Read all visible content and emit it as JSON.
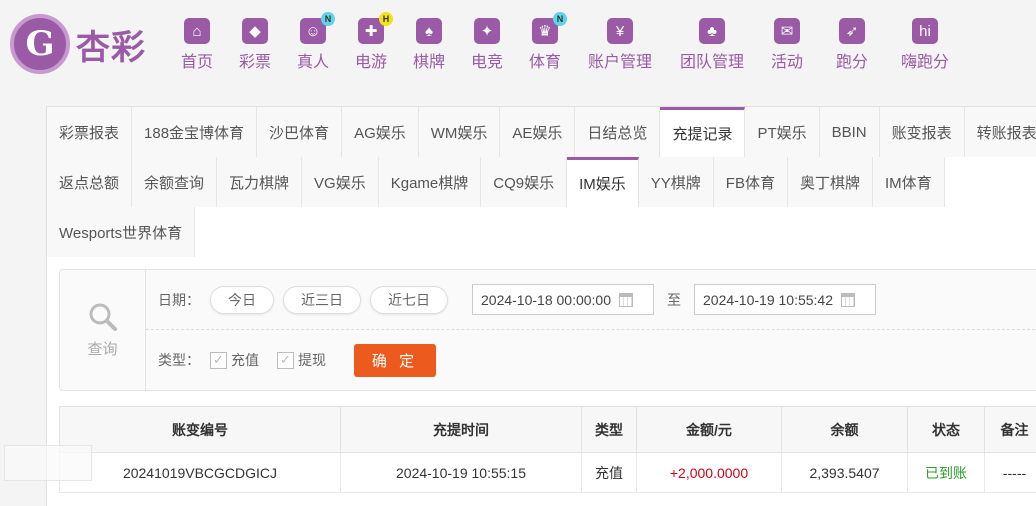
{
  "brand": {
    "logo_glyph": "G",
    "name": "杏彩"
  },
  "nav": [
    {
      "label": "首页",
      "icon": "home-icon",
      "glyph": "⌂",
      "badge": ""
    },
    {
      "label": "彩票",
      "icon": "lottery-icon",
      "glyph": "◆",
      "badge": ""
    },
    {
      "label": "真人",
      "icon": "live-dealer-icon",
      "glyph": "☺",
      "badge": "N"
    },
    {
      "label": "电游",
      "icon": "slot-game-icon",
      "glyph": "✚",
      "badge": "H"
    },
    {
      "label": "棋牌",
      "icon": "cards-icon",
      "glyph": "♠",
      "badge": ""
    },
    {
      "label": "电竞",
      "icon": "esports-icon",
      "glyph": "✦",
      "badge": ""
    },
    {
      "label": "体育",
      "icon": "trophy-icon",
      "glyph": "♛",
      "badge": "N"
    },
    {
      "label": "账户管理",
      "icon": "account-icon",
      "glyph": "¥",
      "badge": ""
    },
    {
      "label": "团队管理",
      "icon": "team-icon",
      "glyph": "♣",
      "badge": ""
    },
    {
      "label": "活动",
      "icon": "gift-icon",
      "glyph": "✉",
      "badge": ""
    },
    {
      "label": "跑分",
      "icon": "running-score-icon",
      "glyph": "➶",
      "badge": ""
    },
    {
      "label": "嗨跑分",
      "icon": "hi-run-icon",
      "glyph": "hi",
      "badge": ""
    }
  ],
  "tabs_row1": [
    "彩票报表",
    "188金宝博体育",
    "沙巴体育",
    "AG娱乐",
    "WM娱乐",
    "AE娱乐",
    "日结总览",
    "充提记录",
    "PT娱乐",
    "BBIN",
    "账变报表",
    "转账报表"
  ],
  "tabs_row2": [
    "返点总额",
    "余额查询",
    "瓦力棋牌",
    "VG娱乐",
    "Kgame棋牌",
    "CQ9娱乐",
    "IM娱乐",
    "YY棋牌",
    "FB体育",
    "奥丁棋牌",
    "IM体育"
  ],
  "tabs_row3": [
    "Wesports世界体育"
  ],
  "active_tabs": [
    "充提记录",
    "IM娱乐"
  ],
  "filter": {
    "query_label": "查询",
    "date_label": "日期：",
    "quick_today": "今日",
    "quick_3days": "近三日",
    "quick_7days": "近七日",
    "date_from": "2024-10-18 00:00:00",
    "to_label": "至",
    "date_to": "2024-10-19 10:55:42",
    "type_label": "类型：",
    "type_deposit": "充值",
    "type_withdraw": "提现",
    "confirm": "确 定"
  },
  "table": {
    "headers": [
      "账变编号",
      "充提时间",
      "类型",
      "金额/元",
      "余额",
      "状态",
      "备注"
    ],
    "rows": [
      [
        "20241019VBCGCDGICJ",
        "2024-10-19 10:55:15",
        "充值",
        "+2,000.0000",
        "2,393.5407",
        "已到账",
        "-----"
      ]
    ]
  },
  "colors": {
    "brand": "#9a5aa6",
    "confirm_button": "#ec5a1d",
    "amount_positive": "#d0021b",
    "status_done": "#2a9a2a"
  }
}
